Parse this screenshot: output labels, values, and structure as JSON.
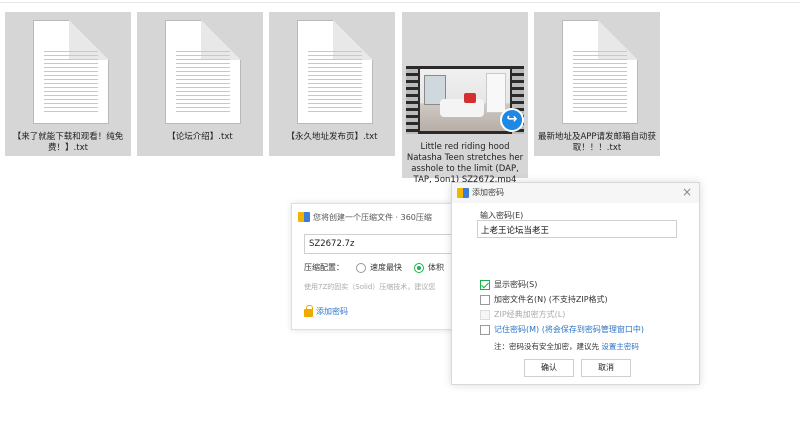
{
  "files": [
    {
      "name": "【来了就能下载和观看！纯免费！】.txt",
      "type": "txt"
    },
    {
      "name": "【论坛介绍】.txt",
      "type": "txt"
    },
    {
      "name": "【永久地址发布页】.txt",
      "type": "txt"
    },
    {
      "name": "Little red riding hood Natasha Teen stretches her asshole to the limit (DAP, TAP, 5on1) SZ2672.mp4",
      "type": "video"
    },
    {
      "name": "最新地址及APP请发邮箱自动获取！！！.txt",
      "type": "txt"
    }
  ],
  "zip_dialog": {
    "title": "您将创建一个压缩文件 · 360压缩",
    "filename": "SZ2672.7z",
    "config_label": "压缩配置：",
    "option_fast": "速度最快",
    "option_small": "体积",
    "description": "使用7Z的固实（Solid）压缩技术，建议您",
    "add_password": "添加密码"
  },
  "password_dialog": {
    "title": "添加密码",
    "close": "×",
    "input_label": "输入密码(E)",
    "password_value": "上老王论坛当老王",
    "show_password": "显示密码(S)",
    "encrypt_filename": "加密文件名(N) (不支持ZIP格式)",
    "zip_classic": "ZIP经典加密方式(L)",
    "remember_password": "记住密码(M)",
    "remember_hint": " (将会保存到密码管理窗口中)",
    "note_prefix": "注：密码没有安全加密，建议先 ",
    "note_link": "设置主密码",
    "ok": "确认",
    "cancel": "取消"
  }
}
